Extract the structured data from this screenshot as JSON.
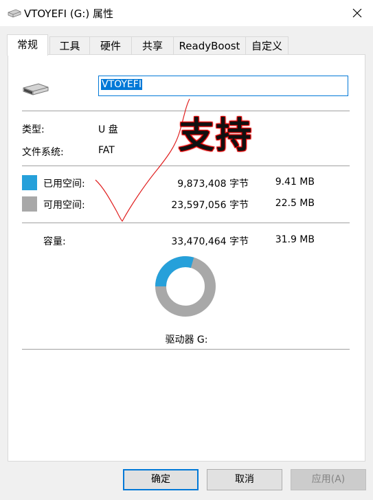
{
  "window": {
    "title": "VTOYEFI (G:) 属性",
    "close_icon": "close-icon",
    "drive_icon": "usb-drive-icon"
  },
  "tabs": [
    {
      "label": "常规",
      "active": true
    },
    {
      "label": "工具"
    },
    {
      "label": "硬件"
    },
    {
      "label": "共享"
    },
    {
      "label": "ReadyBoost"
    },
    {
      "label": "自定义"
    }
  ],
  "general": {
    "name_value": "VTOYEFI",
    "type_label": "类型:",
    "type_value": "U 盘",
    "fs_label": "文件系统:",
    "fs_value": "FAT",
    "used_label": "已用空间:",
    "used_bytes": "9,873,408 字节",
    "used_size": "9.41 MB",
    "free_label": "可用空间:",
    "free_bytes": "23,597,056 字节",
    "free_size": "22.5 MB",
    "capacity_label": "容量:",
    "capacity_bytes": "33,470,464 字节",
    "capacity_size": "31.9 MB",
    "drive_label": "驱动器 G:",
    "used_color": "#26a0da",
    "free_color": "#a8a8a8",
    "used_fraction": 0.295
  },
  "annotation": {
    "text": "支持",
    "color": "#e00000"
  },
  "buttons": {
    "ok": "确定",
    "cancel": "取消",
    "apply": "应用(A)"
  }
}
